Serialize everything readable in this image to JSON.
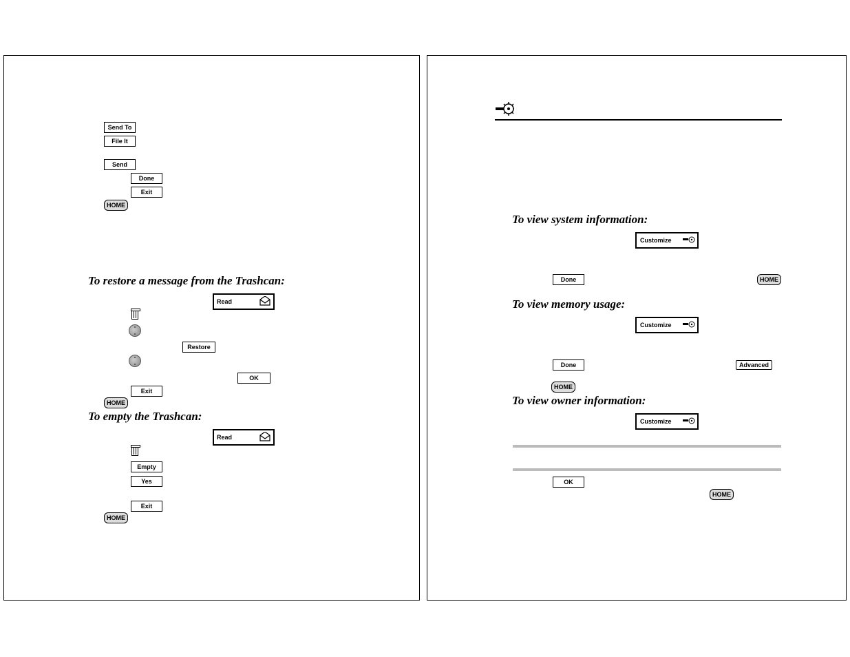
{
  "left": {
    "buttons": {
      "sendTo": "Send To",
      "fileIt": "File It",
      "send": "Send",
      "done": "Done",
      "exit1": "Exit",
      "home1": "HOME",
      "restore": "Restore",
      "ok": "OK",
      "exit2": "Exit",
      "home2": "HOME",
      "empty": "Empty",
      "yes": "Yes",
      "exit3": "Exit",
      "home3": "HOME",
      "read1": "Read",
      "read2": "Read"
    },
    "headings": {
      "restore": "To restore a message from the Trashcan:",
      "empty": "To empty the Trashcan:"
    }
  },
  "right": {
    "buttons": {
      "customize1": "Customize",
      "customize2": "Customize",
      "customize3": "Customize",
      "done1": "Done",
      "done2": "Done",
      "home1": "HOME",
      "home2": "HOME",
      "home3": "HOME",
      "advanced": "Advanced",
      "ok": "OK"
    },
    "headings": {
      "sysInfo": "To view system information:",
      "memUsage": "To view memory usage:",
      "ownerInfo": "To view owner information:"
    }
  }
}
